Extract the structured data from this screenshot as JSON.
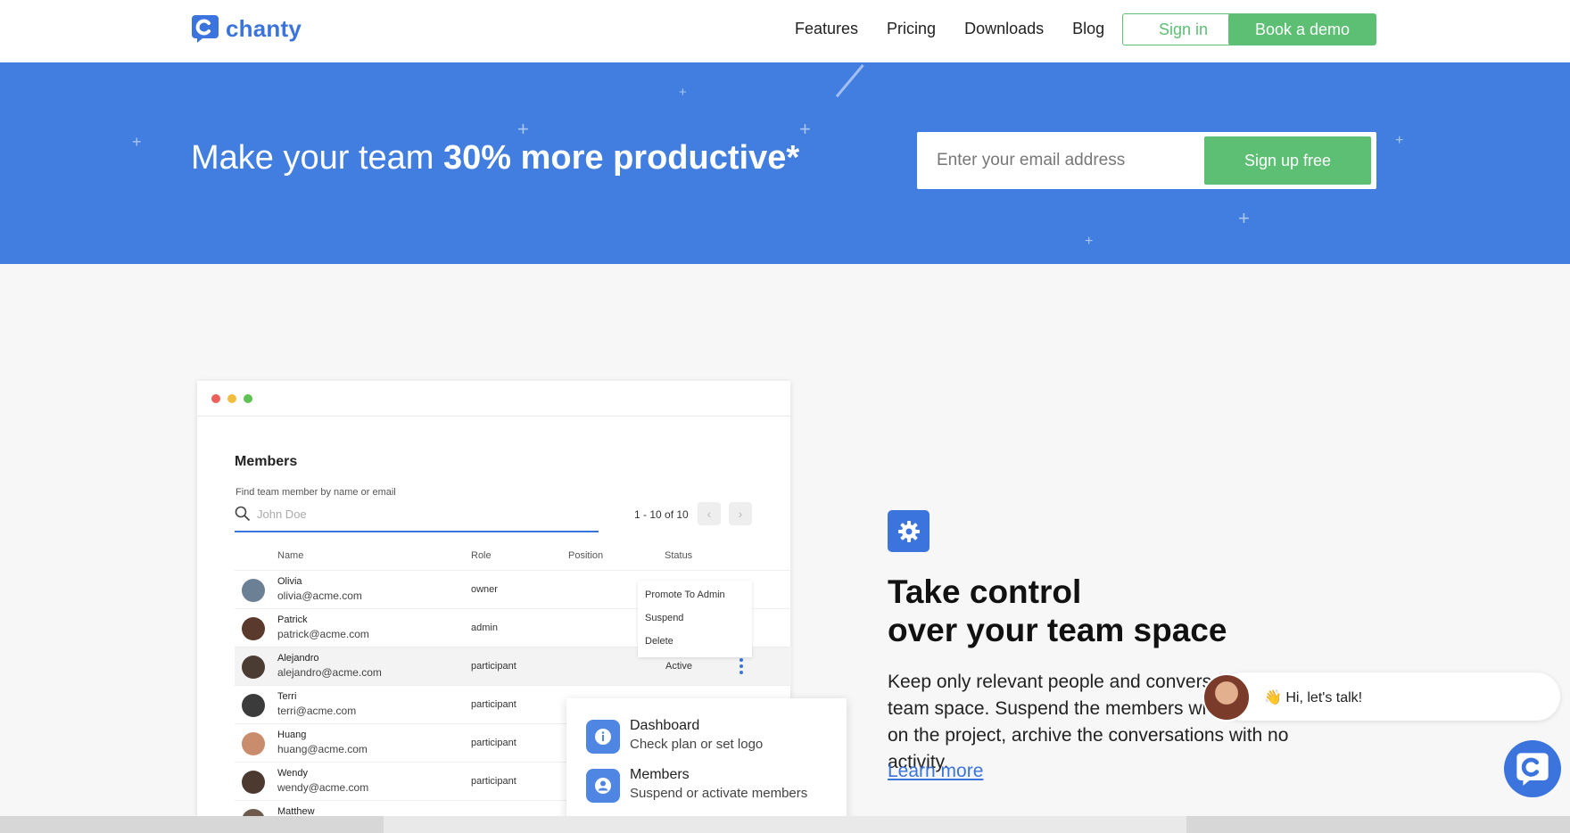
{
  "header": {
    "brand": "chanty",
    "nav": [
      "Features",
      "Pricing",
      "Downloads",
      "Blog"
    ],
    "signin_label": "Sign in",
    "demo_label": "Book a demo"
  },
  "hero": {
    "title_plain": "Make your team ",
    "title_bold": "30% more productive*",
    "email_placeholder": "Enter your email address",
    "signup_label": "Sign up free"
  },
  "members_mock": {
    "title": "Members",
    "find_label": "Find team member by name or email",
    "search_placeholder": "John Doe",
    "pager_text": "1 - 10 of 10",
    "columns": [
      "Name",
      "Role",
      "Position",
      "Status"
    ],
    "rows": [
      {
        "name": "Olivia",
        "email": "olivia@acme.com",
        "role": "owner",
        "status": ""
      },
      {
        "name": "Patrick",
        "email": "patrick@acme.com",
        "role": "admin",
        "status": ""
      },
      {
        "name": "Alejandro",
        "email": "alejandro@acme.com",
        "role": "participant",
        "status": "Active"
      },
      {
        "name": "Terri",
        "email": "terri@acme.com",
        "role": "participant",
        "status": ""
      },
      {
        "name": "Huang",
        "email": "huang@acme.com",
        "role": "participant",
        "status": ""
      },
      {
        "name": "Wendy",
        "email": "wendy@acme.com",
        "role": "participant",
        "status": ""
      },
      {
        "name": "Matthew",
        "email": "",
        "role": "",
        "status": ""
      }
    ],
    "context_menu": [
      "Promote To Admin",
      "Suspend",
      "Delete"
    ],
    "popup": [
      {
        "title": "Dashboard",
        "subtitle": "Check plan or set logo",
        "icon": "info-icon"
      },
      {
        "title": "Members",
        "subtitle": "Suspend or activate members",
        "icon": "user-icon"
      }
    ]
  },
  "feature": {
    "icon": "gear-icon",
    "title_line1": "Take control",
    "title_line2": "over your team space",
    "description": "Keep only relevant people and conversations in your team space. Suspend the members who are no longer on the project, archive the conversations with no activity.",
    "learn_more": "Learn more"
  },
  "chat": {
    "greeting": "👋  Hi, let's talk!"
  },
  "colors": {
    "brand_blue": "#3b74dc",
    "hero_blue": "#427ee0",
    "green": "#5cbf73"
  }
}
